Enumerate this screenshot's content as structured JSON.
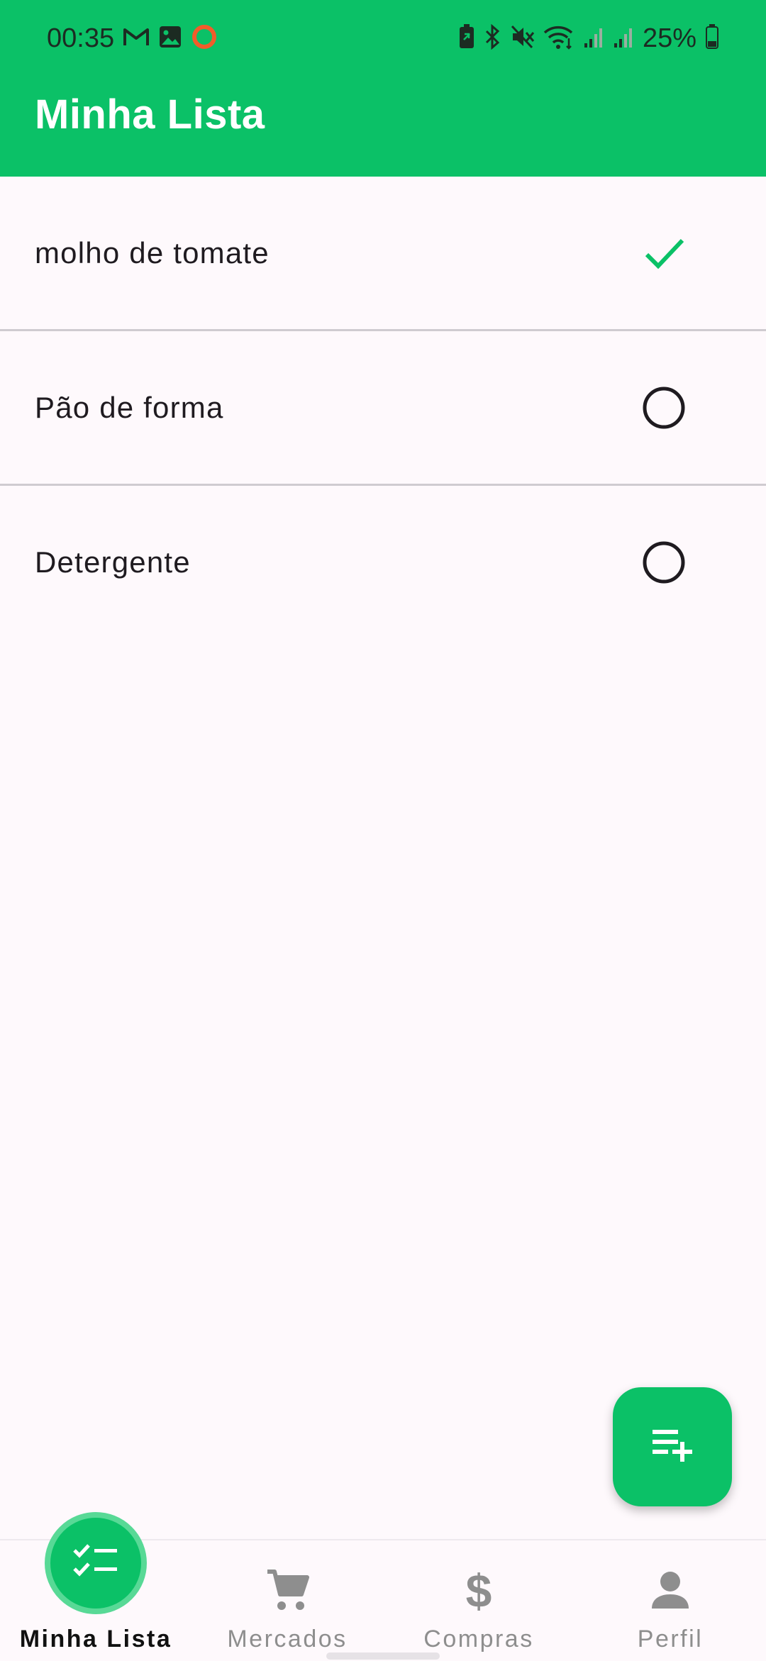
{
  "status_bar": {
    "time": "00:35",
    "battery": "25%",
    "left_icons": [
      "gmail-icon",
      "gallery-icon",
      "record-icon"
    ],
    "right_icons": [
      "battery-saver-icon",
      "bluetooth-icon",
      "mute-icon",
      "wifi-icon",
      "signal-icon",
      "signal-icon",
      "battery-icon"
    ]
  },
  "app_bar": {
    "title": "Minha Lista"
  },
  "list": {
    "items": [
      {
        "label": "molho de tomate",
        "checked": true
      },
      {
        "label": "Pão de forma",
        "checked": false
      },
      {
        "label": "Detergente",
        "checked": false
      }
    ]
  },
  "fab": {
    "icon": "playlist-add-icon"
  },
  "nav": {
    "items": [
      {
        "label": "Minha Lista",
        "icon": "checklist-icon",
        "active": true
      },
      {
        "label": "Mercados",
        "icon": "cart-icon",
        "active": false
      },
      {
        "label": "Compras",
        "icon": "dollar-icon",
        "active": false
      },
      {
        "label": "Perfil",
        "icon": "person-icon",
        "active": false
      }
    ]
  },
  "colors": {
    "primary": "#0BC167",
    "primary_light": "#58D996",
    "background": "#FEF9FC",
    "divider": "#CFCBD0",
    "inactive": "#8E8E8E"
  }
}
